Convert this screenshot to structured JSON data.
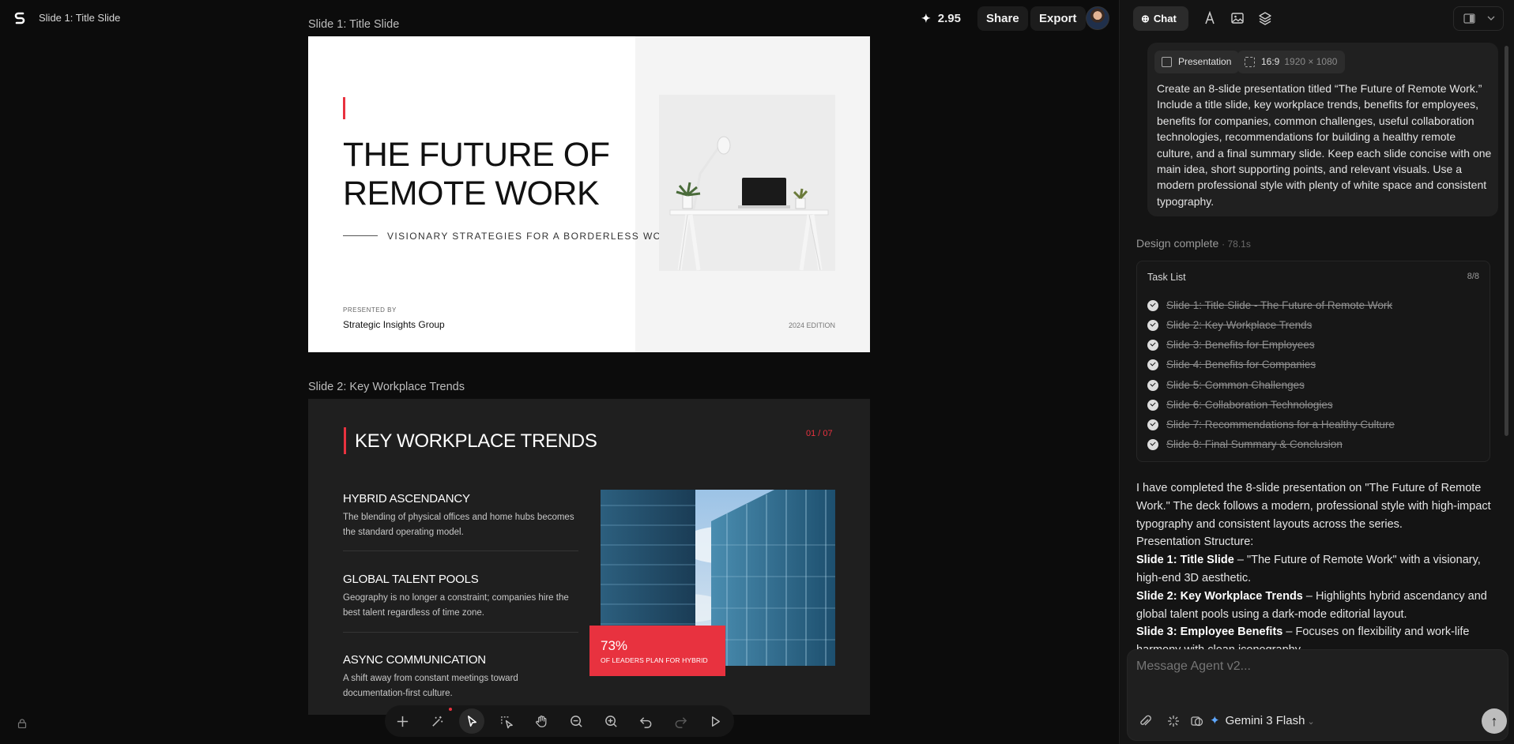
{
  "header": {
    "doc_title": "Slide 1: Title Slide",
    "credits": "2.95",
    "share_label": "Share",
    "export_label": "Export"
  },
  "slides": [
    {
      "label": "Slide 1: Title Slide",
      "title_line1": "THE FUTURE OF",
      "title_line2": "REMOTE WORK",
      "subtitle": "VISIONARY STRATEGIES FOR A BORDERLESS WORKP",
      "presented_by": "PRESENTED BY",
      "group": "Strategic Insights Group",
      "edition": "2024 EDITION"
    },
    {
      "label": "Slide 2: Key Workplace Trends",
      "title": "KEY WORKPLACE TRENDS",
      "counter": "01 / 07",
      "items": [
        {
          "heading": "HYBRID ASCENDANCY",
          "text": "The blending of physical offices and home hubs becomes the standard operating model."
        },
        {
          "heading": "GLOBAL TALENT POOLS",
          "text": "Geography is no longer a constraint; companies hire the best talent regardless of time zone."
        },
        {
          "heading": "ASYNC COMMUNICATION",
          "text": "A shift away from constant meetings toward documentation-first culture."
        }
      ],
      "stat_value": "73%",
      "stat_label": "OF LEADERS PLAN FOR HYBRID"
    }
  ],
  "toolbar": {
    "tools": [
      "add-icon",
      "magic-wand-icon",
      "pointer-icon",
      "select-frame-icon",
      "hand-icon",
      "zoom-out-icon",
      "zoom-in-icon",
      "undo-icon",
      "redo-icon",
      "play-icon"
    ]
  },
  "panel": {
    "chat_label": "Chat",
    "chip_type": "Presentation",
    "chip_ratio": "16:9",
    "chip_size": "1920 × 1080",
    "prompt": "Create an 8-slide presentation titled “The Future of Remote Work.” Include a title slide, key workplace trends, benefits for employees, benefits for companies, common challenges, useful collaboration technologies, recommendations for building a healthy remote culture, and a final summary slide. Keep each slide concise with one main idea, short supporting points, and relevant visuals. Use a modern professional style with plenty of white space and consistent typography.",
    "design_status": "Design complete",
    "design_time": "· 78.1s",
    "task_title": "Task List",
    "task_count": "8/8",
    "tasks": [
      "Slide 1: Title Slide - The Future of Remote Work",
      "Slide 2: Key Workplace Trends",
      "Slide 3: Benefits for Employees",
      "Slide 4: Benefits for Companies",
      "Slide 5: Common Challenges",
      "Slide 6: Collaboration Technologies",
      "Slide 7: Recommendations for a Healthy Culture",
      "Slide 8: Final Summary & Conclusion"
    ],
    "message_intro": "I have completed the 8-slide presentation on \"The Future of Remote Work.\" The deck follows a modern, professional style with high-impact typography and consistent layouts across the series.",
    "structure_label": "Presentation Structure:",
    "structure": [
      {
        "name": "Slide 1: Title Slide",
        "desc": " – \"The Future of Remote Work\" with a visionary, high-end 3D aesthetic."
      },
      {
        "name": "Slide 2: Key Workplace Trends",
        "desc": " – Highlights hybrid ascendancy and global talent pools using a dark-mode editorial layout."
      },
      {
        "name": "Slide 3: Employee Benefits",
        "desc": " – Focuses on flexibility and work-life harmony with clean iconography."
      }
    ],
    "input_placeholder": "Message Agent v2...",
    "model": "Gemini 3 Flash"
  }
}
